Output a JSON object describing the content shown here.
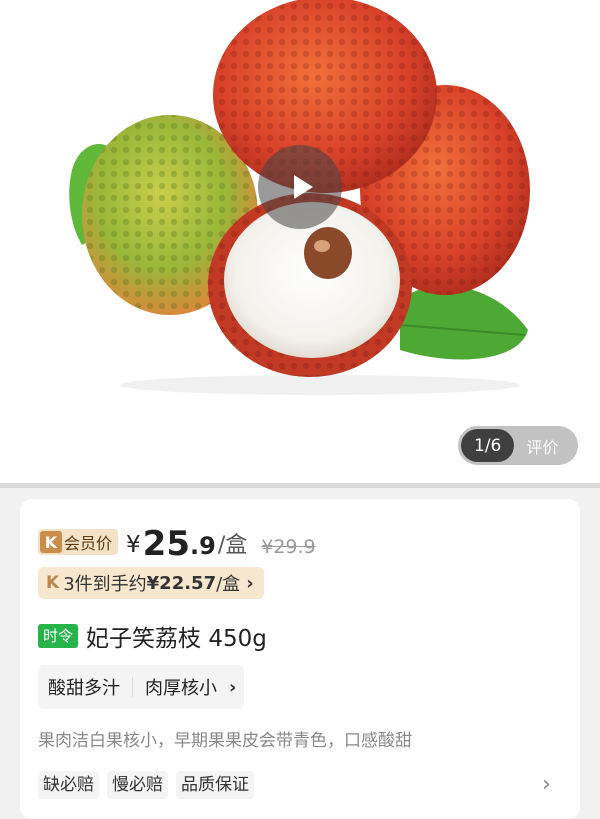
{
  "hero": {
    "gallery_counter": "1/6",
    "review_label": "评价"
  },
  "price": {
    "member_logo": "K",
    "member_label": "会员价",
    "currency": "¥",
    "integer": "25",
    "decimal": ".9",
    "unit": "/盒",
    "original": "¥29.9"
  },
  "bundle": {
    "logo": "K",
    "text": "3件到手约",
    "price": "¥22.57",
    "unit": "/盒",
    "chevron": "›"
  },
  "product": {
    "season_tag": "时令",
    "title": "妃子笑荔枝 450g"
  },
  "features": {
    "items": [
      "酸甜多汁",
      "肉厚核小"
    ],
    "chevron": "›"
  },
  "description": "果肉洁白果核小，早期果果皮会带青色，口感酸甜",
  "services": {
    "items": [
      "缺必赔",
      "慢必赔",
      "品质保证"
    ],
    "chevron": "›"
  },
  "colors": {
    "season_green": "#25b34a",
    "member_gold": "#c98f4a",
    "bundle_bg": "#f7e7cf"
  }
}
